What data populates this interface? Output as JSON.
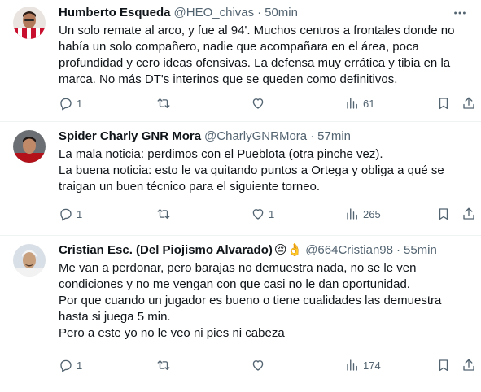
{
  "tweets": [
    {
      "name": "Humberto Esqueda",
      "handle": "@HEO_chivas",
      "separator": "·",
      "time": "50min",
      "lines": [
        "Un solo remate al arco, y fue al 94'. Muchos centros a frontales donde no",
        "había un solo compañero, nadie que acompañara en el área, poca",
        "profundidad y cero ideas ofensivas. La defensa muy errática y tibia en la",
        "marca. No más DT's interinos que se queden como definitivos."
      ],
      "replies": "1",
      "retweets": "",
      "likes": "",
      "views": "61"
    },
    {
      "name": "Spider Charly GNR Mora",
      "handle": "@CharlyGNRMora",
      "separator": "·",
      "time": "57min",
      "lines": [
        "La mala noticia: perdimos con el Pueblota (otra pinche vez).",
        "La buena noticia: esto le va quitando puntos a Ortega y obliga a qué se",
        "traigan un buen técnico para el siguiente torneo."
      ],
      "replies": "1",
      "retweets": "",
      "likes": "1",
      "views": "265"
    },
    {
      "name": "Cristian Esc. (Del Piojismo Alvarado)",
      "emoji": "😔👌",
      "handle": "@664Cristian98",
      "separator": "·",
      "time": "55min",
      "lines": [
        "Me van a perdonar, pero barajas no demuestra nada, no se le ven",
        "condiciones y no me vengan con que casi no le dan oportunidad.",
        "Por que cuando un jugador es bueno o tiene cualidades las demuestra",
        "hasta si juega 5 min.",
        "Pero a este yo no le veo ni pies ni cabeza"
      ],
      "replies": "1",
      "retweets": "",
      "likes": "",
      "views": "174"
    }
  ],
  "more_label": "···",
  "colors": {
    "text": "#0f1419",
    "secondary": "#536471",
    "divider": "#eff3f4"
  },
  "icons": [
    "reply-icon",
    "retweet-icon",
    "like-icon",
    "views-icon",
    "bookmark-icon",
    "share-icon",
    "more-icon"
  ]
}
